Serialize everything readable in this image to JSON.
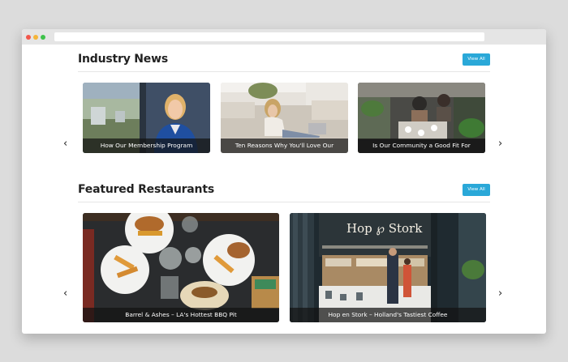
{
  "colors": {
    "accent": "#2aa8d8",
    "dot_red": "#f2574c",
    "dot_yellow": "#f5b53a",
    "dot_green": "#3ec24a"
  },
  "browser": {
    "window_controls": [
      "close",
      "minimize",
      "maximize"
    ]
  },
  "industry_news": {
    "title": "Industry News",
    "view_all_label": "View All",
    "prev_icon": "chevron-left-icon",
    "next_icon": "chevron-right-icon",
    "cards": [
      {
        "caption": "How Our Membership Program"
      },
      {
        "caption": "Ten Reasons Why You'll Love Our"
      },
      {
        "caption": "Is Our Community a Good Fit For"
      }
    ]
  },
  "featured_restaurants": {
    "title": "Featured Restaurants",
    "view_all_label": "View All",
    "prev_icon": "chevron-left-icon",
    "next_icon": "chevron-right-icon",
    "cards": [
      {
        "caption": "Barrel & Ashes – LA's Hottest BBQ Pit"
      },
      {
        "caption": "Hop en Stork – Holland's Tastiest Coffee"
      }
    ]
  }
}
